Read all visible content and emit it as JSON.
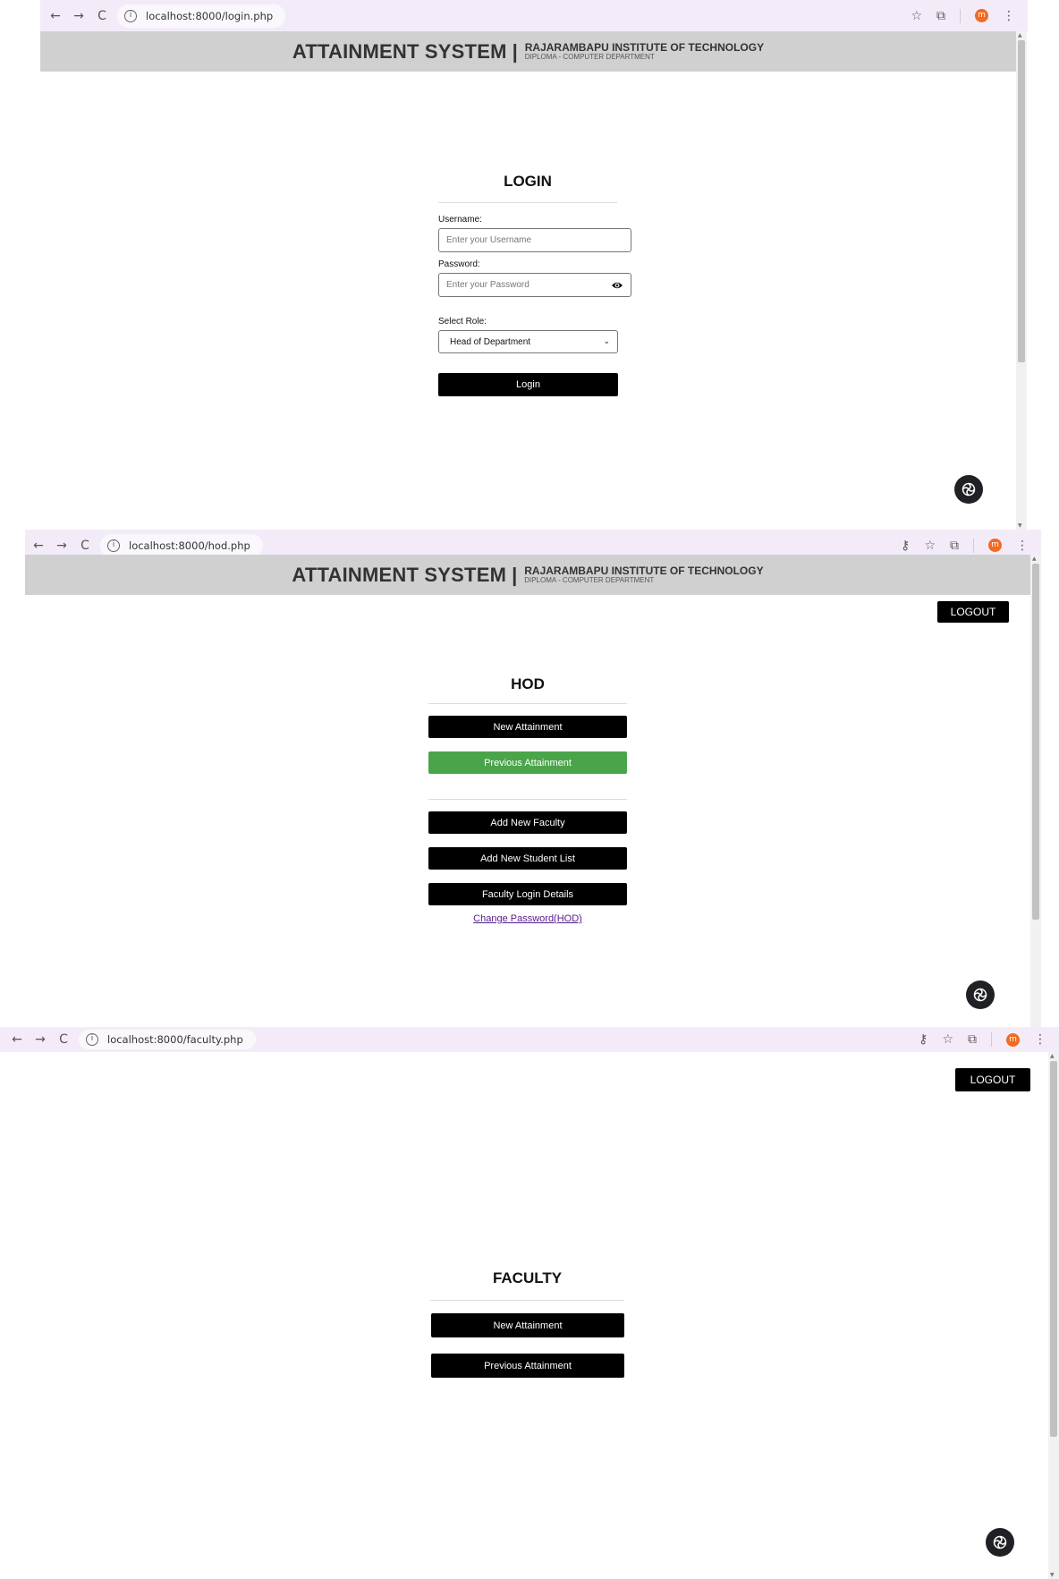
{
  "app": {
    "title": "ATTAINMENT SYSTEM",
    "separator": "|",
    "institute": "RAJARAMBAPU INSTITUTE OF TECHNOLOGY",
    "department": "DIPLOMA - COMPUTER DEPARTMENT"
  },
  "icons": {
    "back": "←",
    "forward": "→",
    "reload": "C",
    "info": "i",
    "star": "☆",
    "key": "⚷",
    "extensions": "⧉",
    "profile": "m",
    "menu": "⋮",
    "select_arrow": "⌄"
  },
  "colors": {
    "header_bg": "#d0d0d0",
    "button_bg": "#000000",
    "active_button_bg": "#4aa54a",
    "chrome_bg": "#f3ecf8",
    "profile": "#f26a21"
  },
  "login_page": {
    "url": "localhost:8000/login.php",
    "heading": "LOGIN",
    "username_label": "Username:",
    "username_placeholder": "Enter your Username",
    "password_label": "Password:",
    "password_placeholder": "Enter your Password",
    "role_label": "Select Role:",
    "role_selected": "Head of Department",
    "login_button": "Login"
  },
  "hod_page": {
    "url": "localhost:8000/hod.php",
    "logout": "LOGOUT",
    "heading": "HOD",
    "buttons": {
      "new_attainment": "New Attainment",
      "previous_attainment": "Previous Attainment",
      "add_faculty": "Add New Faculty",
      "add_student_list": "Add New Student List",
      "faculty_login_details": "Faculty Login Details"
    },
    "change_password": "Change Password(HOD)"
  },
  "faculty_page": {
    "url": "localhost:8000/faculty.php",
    "logout": "LOGOUT",
    "heading": "FACULTY",
    "buttons": {
      "new_attainment": "New Attainment",
      "previous_attainment": "Previous Attainment"
    }
  }
}
